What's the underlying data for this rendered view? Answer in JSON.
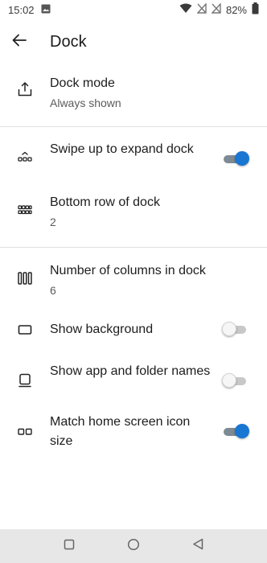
{
  "status_bar": {
    "time": "15:02",
    "battery_percent": "82%",
    "icons": [
      "image-icon",
      "wifi-icon",
      "no-signal-icon",
      "no-signal-icon",
      "battery-icon"
    ]
  },
  "header": {
    "title": "Dock",
    "back_icon": "arrow-left-icon"
  },
  "settings": [
    {
      "id": "dock-mode",
      "icon": "dock-upload-icon",
      "title": "Dock mode",
      "subtitle": "Always shown"
    },
    {
      "id": "swipe-up-expand",
      "icon": "expand-dock-icon",
      "title": "Swipe up to expand dock",
      "toggle": true
    },
    {
      "id": "bottom-row",
      "icon": "grid-icon",
      "title": "Bottom row of dock",
      "subtitle": "2"
    },
    {
      "id": "columns",
      "icon": "columns-icon",
      "title": "Number of columns in dock",
      "subtitle": "6"
    },
    {
      "id": "show-background",
      "icon": "background-rect-icon",
      "title": "Show background",
      "toggle": false
    },
    {
      "id": "show-names",
      "icon": "app-label-icon",
      "title": "Show app and folder names",
      "toggle": false
    },
    {
      "id": "match-icon-size",
      "icon": "icon-size-icon",
      "title": "Match home screen icon size",
      "toggle": true
    }
  ],
  "nav_bar": {
    "icons": [
      "recents-square-icon",
      "home-circle-icon",
      "back-triangle-icon"
    ]
  },
  "colors": {
    "accent": "#1976d2",
    "divider": "#e0e0e0",
    "nav_bar_bg": "#e7e7e7"
  }
}
